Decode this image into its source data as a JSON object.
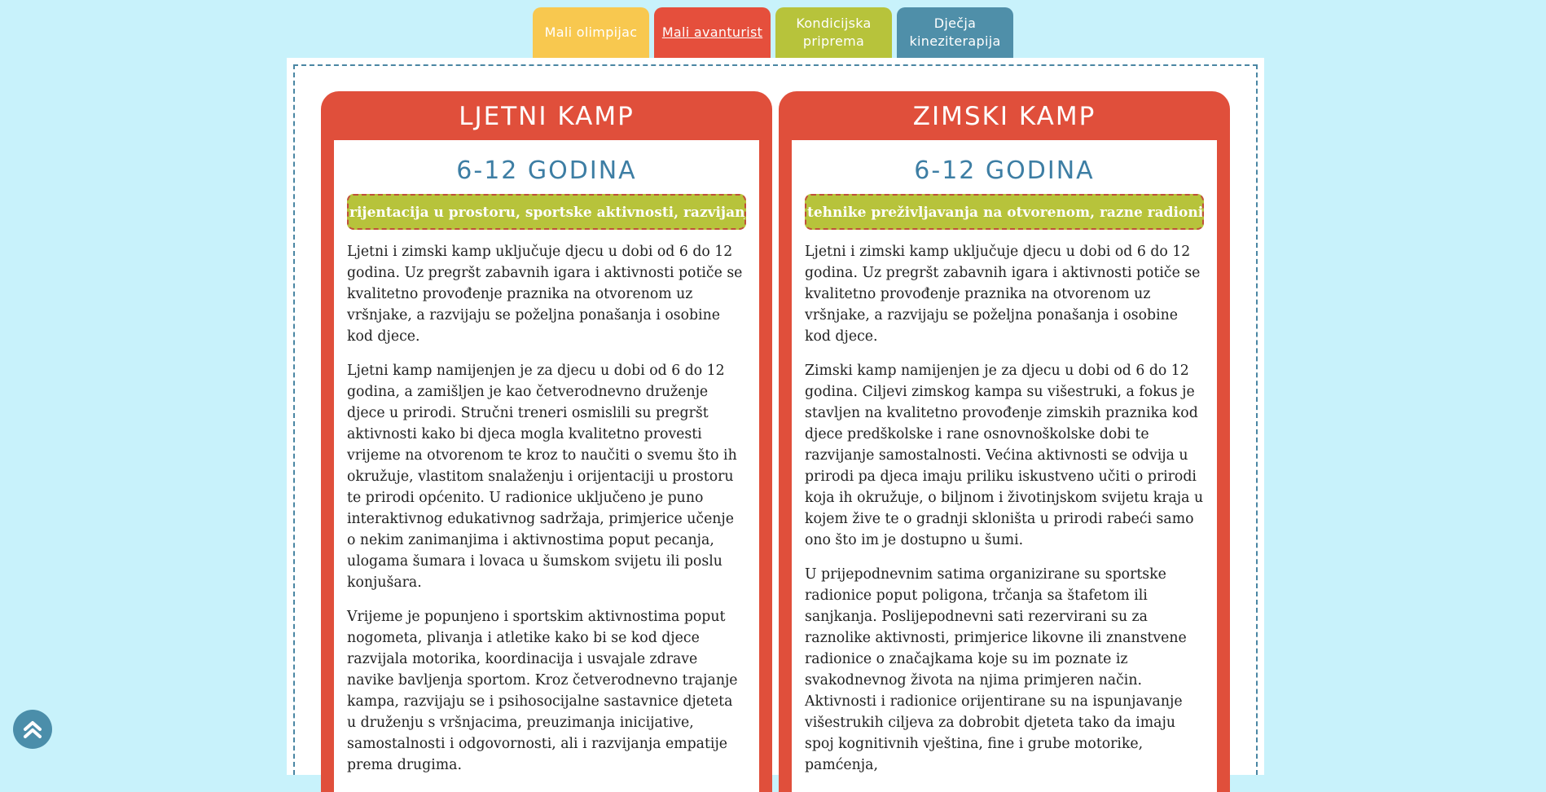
{
  "colors": {
    "background": "#c8f2fb",
    "tab_mali_olimpijac": "#f8c84f",
    "tab_mali_avanturist": "#e54f3c",
    "tab_kondicijska": "#b7c33b",
    "tab_djecja": "#4f8fa9",
    "card": "#e04f3b",
    "tagline": "#b7c33b",
    "heading_blue": "#3d7ea4"
  },
  "tabs": [
    {
      "label": "Mali olimpijac"
    },
    {
      "label": "Mali avanturist"
    },
    {
      "label": "Kondicijska priprema"
    },
    {
      "label": "Dječja kineziterapija"
    }
  ],
  "active_tab": "Mali avanturist",
  "cards": [
    {
      "title": "LJETNI KAMP",
      "age": "6-12 GODINA",
      "tagline": "rijentacija u prostoru, sportske aktivnosti, razvijanje emp",
      "paragraphs": [
        "Ljetni i zimski kamp uključuje djecu u dobi od 6 do 12 godina. Uz pregršt zabavnih igara i aktivnosti potiče se kvalitetno provođenje praznika na otvorenom uz vršnjake, a razvijaju se poželjna ponašanja i osobine kod djece.",
        "Ljetni kamp namijenjen je za djecu u dobi od 6 do 12 godina, a zamišljen je kao četverodnevno druženje djece u prirodi. Stručni treneri osmislili su pregršt aktivnosti kako bi djeca mogla kvalitetno provesti vrijeme na otvorenom te kroz to naučiti o svemu što ih okružuje, vlastitom snalaženju i orijentaciji u prostoru te prirodi općenito. U radionice uključeno je puno interaktivnog edukativnog sadržaja, primjerice učenje o nekim zanimanjima i aktivnostima poput pecanja, ulogama šumara i lovaca u šumskom svijetu ili poslu konjušara.",
        "Vrijeme je popunjeno i sportskim aktivnostima poput nogometa, plivanja i atletike kako bi se kod djece razvijala motorika, koordinacija i usvajale zdrave navike bavljenja sportom. Kroz četverodnevno trajanje kampa, razvijaju se i psihosocijalne sastavnice djeteta u druženju s vršnjacima, preuzimanja inicijative, samostalnosti i odgovornosti, ali i razvijanja empatije prema drugima."
      ]
    },
    {
      "title": "ZIMSKI KAMP",
      "age": "6-12 GODINA",
      "tagline": "tehnike preživljavanja na otvorenom, razne radionice.",
      "paragraphs": [
        "Ljetni i zimski kamp uključuje djecu u dobi od 6 do 12 godina. Uz pregršt zabavnih igara i aktivnosti potiče se kvalitetno provođenje praznika na otvorenom uz vršnjake, a razvijaju se poželjna ponašanja i osobine kod djece.",
        "Zimski kamp namijenjen je za djecu u dobi od 6 do 12 godina. Ciljevi zimskog kampa su višestruki, a fokus je stavljen na kvalitetno provođenje zimskih praznika kod djece predškolske i rane osnovnoškolske dobi te razvijanje samostalnosti. Većina aktivnosti se odvija u prirodi pa djeca imaju priliku iskustveno učiti o prirodi koja ih okružuje, o biljnom i životinjskom svijetu kraja u kojem žive te o gradnji skloništa u prirodi rabeći samo ono što im je dostupno u šumi.",
        "U prijepodnevnim satima organizirane su sportske radionice poput poligona, trčanja sa štafetom ili sanjkanja. Poslijepodnevni sati rezervirani su za raznolike aktivnosti, primjerice likovne ili znanstvene radionice o značajkama koje su im poznate iz svakodnevnog života na njima primjeren način. Aktivnosti i radionice orijentirane su na ispunjavanje višestrukih ciljeva za dobrobit djeteta tako da imaju spoj kognitivnih vještina, fine i grube motorike, pamćenja,"
      ]
    }
  ],
  "scroll_top_icon": "double-chevron-up-icon"
}
